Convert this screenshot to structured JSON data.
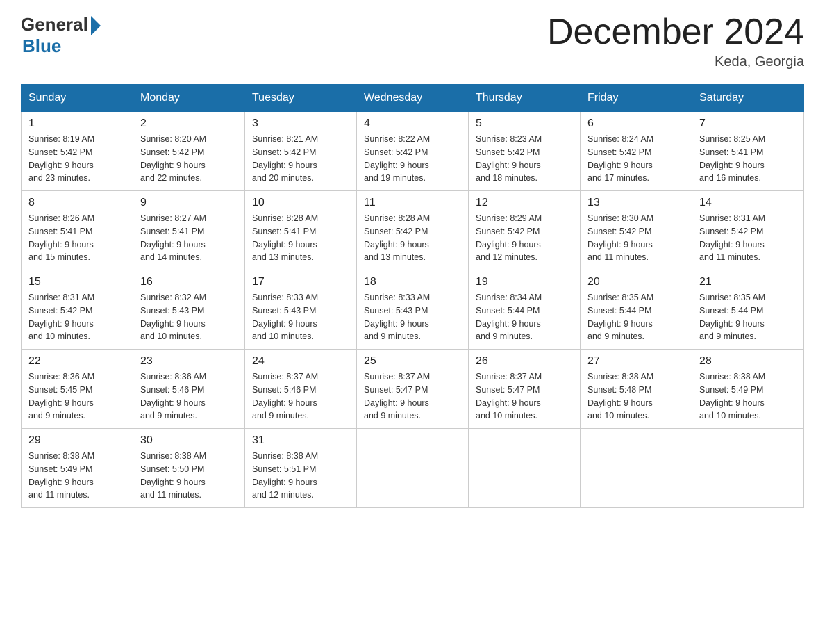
{
  "logo": {
    "general": "General",
    "blue": "Blue"
  },
  "title": "December 2024",
  "location": "Keda, Georgia",
  "weekdays": [
    "Sunday",
    "Monday",
    "Tuesday",
    "Wednesday",
    "Thursday",
    "Friday",
    "Saturday"
  ],
  "weeks": [
    [
      {
        "day": "1",
        "info": "Sunrise: 8:19 AM\nSunset: 5:42 PM\nDaylight: 9 hours\nand 23 minutes."
      },
      {
        "day": "2",
        "info": "Sunrise: 8:20 AM\nSunset: 5:42 PM\nDaylight: 9 hours\nand 22 minutes."
      },
      {
        "day": "3",
        "info": "Sunrise: 8:21 AM\nSunset: 5:42 PM\nDaylight: 9 hours\nand 20 minutes."
      },
      {
        "day": "4",
        "info": "Sunrise: 8:22 AM\nSunset: 5:42 PM\nDaylight: 9 hours\nand 19 minutes."
      },
      {
        "day": "5",
        "info": "Sunrise: 8:23 AM\nSunset: 5:42 PM\nDaylight: 9 hours\nand 18 minutes."
      },
      {
        "day": "6",
        "info": "Sunrise: 8:24 AM\nSunset: 5:42 PM\nDaylight: 9 hours\nand 17 minutes."
      },
      {
        "day": "7",
        "info": "Sunrise: 8:25 AM\nSunset: 5:41 PM\nDaylight: 9 hours\nand 16 minutes."
      }
    ],
    [
      {
        "day": "8",
        "info": "Sunrise: 8:26 AM\nSunset: 5:41 PM\nDaylight: 9 hours\nand 15 minutes."
      },
      {
        "day": "9",
        "info": "Sunrise: 8:27 AM\nSunset: 5:41 PM\nDaylight: 9 hours\nand 14 minutes."
      },
      {
        "day": "10",
        "info": "Sunrise: 8:28 AM\nSunset: 5:41 PM\nDaylight: 9 hours\nand 13 minutes."
      },
      {
        "day": "11",
        "info": "Sunrise: 8:28 AM\nSunset: 5:42 PM\nDaylight: 9 hours\nand 13 minutes."
      },
      {
        "day": "12",
        "info": "Sunrise: 8:29 AM\nSunset: 5:42 PM\nDaylight: 9 hours\nand 12 minutes."
      },
      {
        "day": "13",
        "info": "Sunrise: 8:30 AM\nSunset: 5:42 PM\nDaylight: 9 hours\nand 11 minutes."
      },
      {
        "day": "14",
        "info": "Sunrise: 8:31 AM\nSunset: 5:42 PM\nDaylight: 9 hours\nand 11 minutes."
      }
    ],
    [
      {
        "day": "15",
        "info": "Sunrise: 8:31 AM\nSunset: 5:42 PM\nDaylight: 9 hours\nand 10 minutes."
      },
      {
        "day": "16",
        "info": "Sunrise: 8:32 AM\nSunset: 5:43 PM\nDaylight: 9 hours\nand 10 minutes."
      },
      {
        "day": "17",
        "info": "Sunrise: 8:33 AM\nSunset: 5:43 PM\nDaylight: 9 hours\nand 10 minutes."
      },
      {
        "day": "18",
        "info": "Sunrise: 8:33 AM\nSunset: 5:43 PM\nDaylight: 9 hours\nand 9 minutes."
      },
      {
        "day": "19",
        "info": "Sunrise: 8:34 AM\nSunset: 5:44 PM\nDaylight: 9 hours\nand 9 minutes."
      },
      {
        "day": "20",
        "info": "Sunrise: 8:35 AM\nSunset: 5:44 PM\nDaylight: 9 hours\nand 9 minutes."
      },
      {
        "day": "21",
        "info": "Sunrise: 8:35 AM\nSunset: 5:44 PM\nDaylight: 9 hours\nand 9 minutes."
      }
    ],
    [
      {
        "day": "22",
        "info": "Sunrise: 8:36 AM\nSunset: 5:45 PM\nDaylight: 9 hours\nand 9 minutes."
      },
      {
        "day": "23",
        "info": "Sunrise: 8:36 AM\nSunset: 5:46 PM\nDaylight: 9 hours\nand 9 minutes."
      },
      {
        "day": "24",
        "info": "Sunrise: 8:37 AM\nSunset: 5:46 PM\nDaylight: 9 hours\nand 9 minutes."
      },
      {
        "day": "25",
        "info": "Sunrise: 8:37 AM\nSunset: 5:47 PM\nDaylight: 9 hours\nand 9 minutes."
      },
      {
        "day": "26",
        "info": "Sunrise: 8:37 AM\nSunset: 5:47 PM\nDaylight: 9 hours\nand 10 minutes."
      },
      {
        "day": "27",
        "info": "Sunrise: 8:38 AM\nSunset: 5:48 PM\nDaylight: 9 hours\nand 10 minutes."
      },
      {
        "day": "28",
        "info": "Sunrise: 8:38 AM\nSunset: 5:49 PM\nDaylight: 9 hours\nand 10 minutes."
      }
    ],
    [
      {
        "day": "29",
        "info": "Sunrise: 8:38 AM\nSunset: 5:49 PM\nDaylight: 9 hours\nand 11 minutes."
      },
      {
        "day": "30",
        "info": "Sunrise: 8:38 AM\nSunset: 5:50 PM\nDaylight: 9 hours\nand 11 minutes."
      },
      {
        "day": "31",
        "info": "Sunrise: 8:38 AM\nSunset: 5:51 PM\nDaylight: 9 hours\nand 12 minutes."
      },
      null,
      null,
      null,
      null
    ]
  ]
}
